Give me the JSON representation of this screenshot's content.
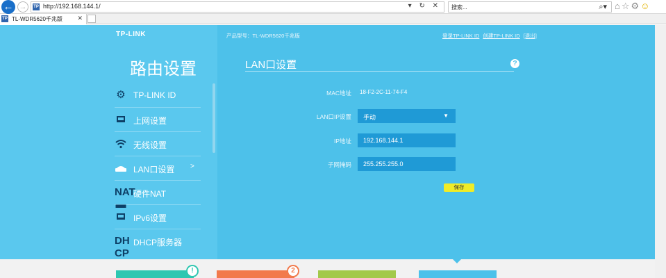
{
  "browser": {
    "url": "http://192.168.144.1/",
    "url_controls": "▾ ↻ ✕",
    "search_placeholder": "搜索...",
    "search_icon": "magnifier-icon",
    "tab_title": "TL-WDR5620千兆版",
    "tab_close": "✕",
    "favicon_text": "TP",
    "tool_icons": [
      "home-icon",
      "star-icon",
      "gear-icon",
      "smiley-icon"
    ]
  },
  "header": {
    "logo": "TP-LINK",
    "model": "产品型号：TL-WDR5620千兆版",
    "links": [
      "登录TP-LINK ID",
      "创建TP-LINK ID",
      "[退出]"
    ]
  },
  "sidebar": {
    "title": "路由设置",
    "items": [
      {
        "label": "TP-LINK ID",
        "icon": "gear-icon",
        "active": false
      },
      {
        "label": "上网设置",
        "icon": "monitor-icon",
        "active": false
      },
      {
        "label": "无线设置",
        "icon": "wifi-icon",
        "active": false
      },
      {
        "label": "LAN口设置",
        "icon": "router-icon",
        "active": true,
        "arrow": ">"
      },
      {
        "label": "硬件NAT",
        "icon": "nat-icon",
        "active": false
      },
      {
        "label": "IPv6设置",
        "icon": "monitor-icon",
        "active": false
      },
      {
        "label": "DHCP服务器",
        "icon": "dhcp-icon",
        "active": false
      }
    ]
  },
  "panel": {
    "title": "LAN口设置",
    "help": "?",
    "fields": {
      "mac_label": "MAC地址",
      "mac_value": "18-F2-2C-11-74-F4",
      "lanip_label": "LAN口IP设置",
      "lanip_value": "手动",
      "ip_label": "IP地址",
      "ip_value": "192.168.144.1",
      "mask_label": "子网掩码",
      "mask_value": "255.255.255.0"
    },
    "save_label": "保存"
  },
  "bottom_cards": [
    {
      "color": "#2ec7b1",
      "badge": "!"
    },
    {
      "color": "#f27a4c",
      "badge": "2"
    },
    {
      "color": "#a3c94a",
      "badge": ""
    },
    {
      "color": "#4dc1ea",
      "badge": ""
    }
  ]
}
